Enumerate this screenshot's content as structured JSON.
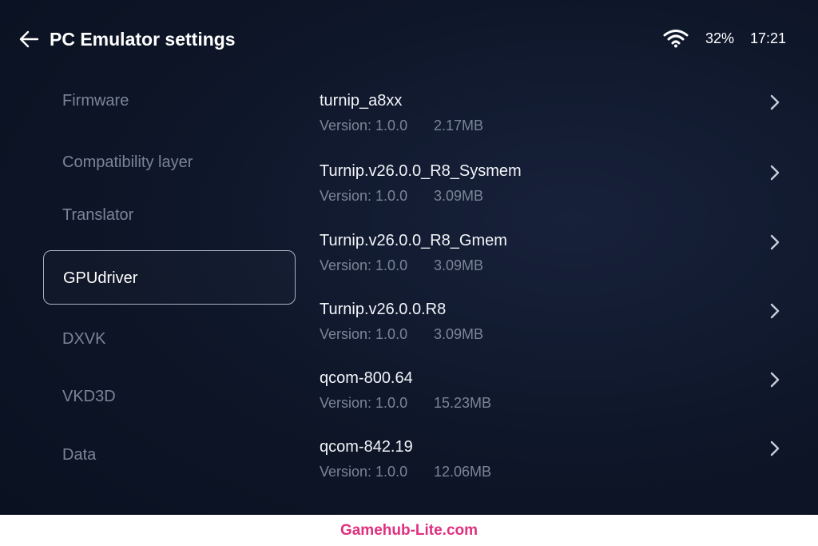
{
  "header": {
    "title": "PC Emulator settings",
    "back_icon": "arrow-left-icon"
  },
  "status_bar": {
    "wifi_icon": "wifi-icon",
    "battery": "32%",
    "time": "17:21"
  },
  "sidebar": {
    "items": [
      {
        "label": "Firmware",
        "active": false
      },
      {
        "label": "Compatibility layer",
        "active": false
      },
      {
        "label": "Translator",
        "active": false
      },
      {
        "label": "GPUdriver",
        "active": true
      },
      {
        "label": "DXVK",
        "active": false
      },
      {
        "label": "VKD3D",
        "active": false
      },
      {
        "label": "Data",
        "active": false
      }
    ]
  },
  "drivers": {
    "items": [
      {
        "name": "turnip_a8xx",
        "version": "Version: 1.0.0",
        "size": "2.17MB"
      },
      {
        "name": "Turnip.v26.0.0_R8_Sysmem",
        "version": "Version: 1.0.0",
        "size": "3.09MB"
      },
      {
        "name": "Turnip.v26.0.0_R8_Gmem",
        "version": "Version: 1.0.0",
        "size": "3.09MB"
      },
      {
        "name": "Turnip.v26.0.0.R8",
        "version": "Version: 1.0.0",
        "size": "3.09MB"
      },
      {
        "name": "qcom-800.64",
        "version": "Version: 1.0.0",
        "size": "15.23MB"
      },
      {
        "name": "qcom-842.19",
        "version": "Version: 1.0.0",
        "size": "12.06MB"
      }
    ],
    "chevron_icon": "chevron-right-icon"
  },
  "footer": {
    "watermark": "Gamehub-Lite.com"
  },
  "colors": {
    "background": "#0d1527",
    "muted_text": "#7b8598",
    "active_border": "#aab3c3",
    "watermark": "#e0307f"
  }
}
